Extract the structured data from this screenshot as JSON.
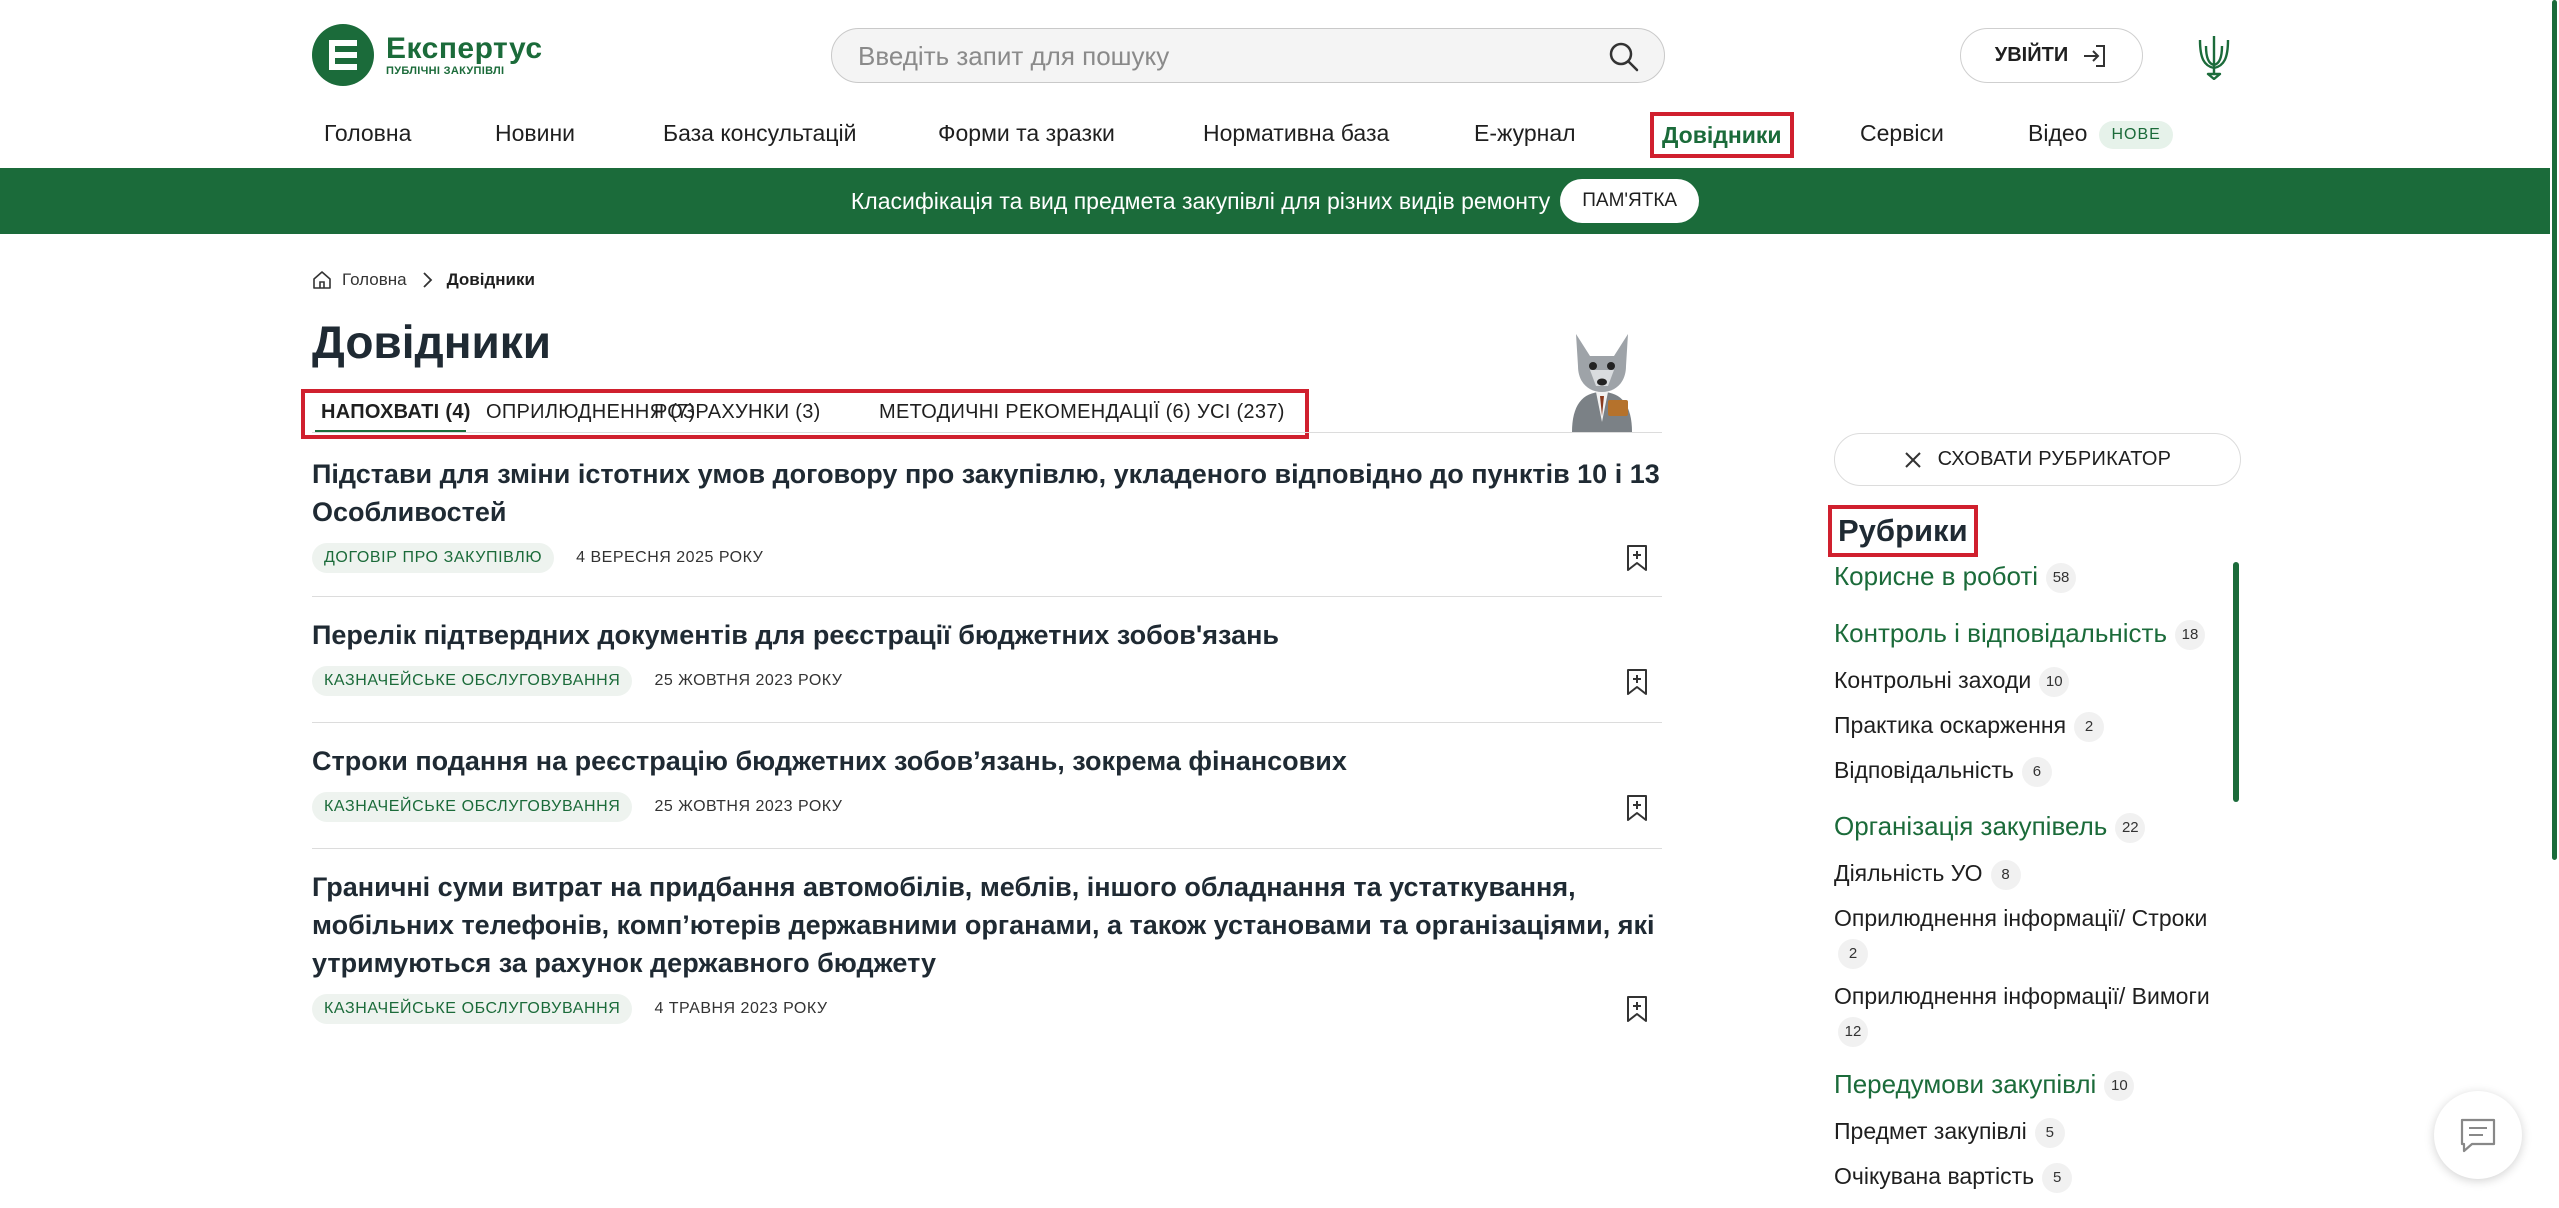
{
  "header": {
    "logo_title": "Експертус",
    "logo_sub": "ПУБЛІЧНІ ЗАКУПІВЛІ",
    "search_placeholder": "Введіть запит для пошуку",
    "login_label": "УВІЙТИ"
  },
  "nav": [
    {
      "label": "Головна"
    },
    {
      "label": "Новини"
    },
    {
      "label": "База консультацій"
    },
    {
      "label": "Форми та зразки"
    },
    {
      "label": "Нормативна база"
    },
    {
      "label": "Е-журнал"
    },
    {
      "label": "Довідники",
      "active": true
    },
    {
      "label": "Сервіси"
    },
    {
      "label": "Відео",
      "badge": "НОВЕ"
    }
  ],
  "banner": {
    "text": "Класифікація та вид предмета закупівлі для різних видів ремонту",
    "button": "ПАМ'ЯТКА"
  },
  "breadcrumb": {
    "home": "Головна",
    "current": "Довідники"
  },
  "page_title": "Довідники",
  "tabs": [
    {
      "label": "НАПОХВАТІ (4)",
      "active": true
    },
    {
      "label": "ОПРИЛЮДНЕННЯ (7)"
    },
    {
      "label": "РОЗРАХУНКИ (3)"
    },
    {
      "label": "МЕТОДИЧНІ РЕКОМЕНДАЦІЇ (6)"
    },
    {
      "label": "УСІ (237)"
    }
  ],
  "articles": [
    {
      "title": "Підстави для зміни істотних умов договору про закупівлю, укладеного відповідно до пунктів 10 і 13 Особливостей",
      "tag": "ДОГОВІР ПРО ЗАКУПІВЛЮ",
      "date": "4 ВЕРЕСНЯ 2025 РОКУ"
    },
    {
      "title": "Перелік підтвердних документів для реєстрації бюджетних зобов'язань",
      "tag": "КАЗНАЧЕЙСЬКЕ ОБСЛУГОВУВАННЯ",
      "date": "25 ЖОВТНЯ 2023 РОКУ"
    },
    {
      "title": "Строки подання на реєстрацію бюджетних зобов’язань, зокрема фінансових",
      "tag": "КАЗНАЧЕЙСЬКЕ ОБСЛУГОВУВАННЯ",
      "date": "25 ЖОВТНЯ 2023 РОКУ"
    },
    {
      "title": "Граничні суми витрат на придбання автомобілів, меблів, іншого обладнання та устаткування, мобільних телефонів, комп’ютерів державними органами, а також установами та організаціями, які утримуються за рахунок державного бюджету",
      "tag": "КАЗНАЧЕЙСЬКЕ ОБСЛУГОВУВАННЯ",
      "date": "4 ТРАВНЯ 2023 РОКУ"
    }
  ],
  "sidebar": {
    "hide_label": "СХОВАТИ РУБРИКАТОР",
    "title": "Рубрики",
    "items": [
      {
        "label": "Корисне в роботі",
        "count": "58",
        "level": "cat"
      },
      {
        "label": "Контроль і відповідальність",
        "count": "18",
        "level": "cat"
      },
      {
        "label": "Контрольні заходи",
        "count": "10",
        "level": "sub"
      },
      {
        "label": "Практика оскарження",
        "count": "2",
        "level": "sub"
      },
      {
        "label": "Відповідальність",
        "count": "6",
        "level": "sub"
      },
      {
        "label": "Організація закупівель",
        "count": "22",
        "level": "cat"
      },
      {
        "label": "Діяльність УО",
        "count": "8",
        "level": "sub"
      },
      {
        "label": "Оприлюднення інформації/ Строки",
        "count": "2",
        "level": "sub"
      },
      {
        "label": "Оприлюднення інформації/ Вимоги",
        "count": "12",
        "level": "sub"
      },
      {
        "label": "Передумови закупівлі",
        "count": "10",
        "level": "cat"
      },
      {
        "label": "Предмет закупівлі",
        "count": "5",
        "level": "sub"
      },
      {
        "label": "Очікувана вартість",
        "count": "5",
        "level": "sub"
      }
    ]
  },
  "colors": {
    "brand_green": "#1b6b3a",
    "highlight_red": "#d0202e"
  }
}
